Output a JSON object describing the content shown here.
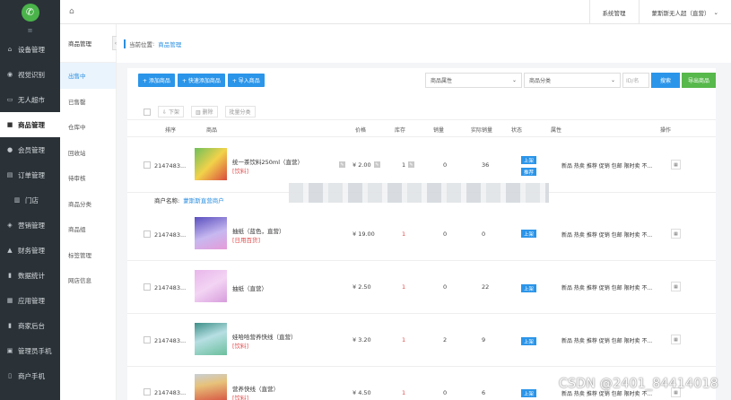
{
  "sidebar": {
    "collapse_glyph": "≡",
    "items": [
      {
        "icon": "⌂",
        "label": "设备管理"
      },
      {
        "icon": "◉",
        "label": "视觉识别"
      },
      {
        "icon": "▭",
        "label": "无人超市"
      },
      {
        "icon": "■",
        "label": "商品管理"
      },
      {
        "icon": "●",
        "label": "会员管理"
      },
      {
        "icon": "▤",
        "label": "订单管理"
      },
      {
        "icon": "▥",
        "label": "门店"
      },
      {
        "icon": "◈",
        "label": "营销管理"
      },
      {
        "icon": "▲",
        "label": "财务管理"
      },
      {
        "icon": "▮",
        "label": "数据统计"
      },
      {
        "icon": "▦",
        "label": "应用管理"
      },
      {
        "icon": "▮",
        "label": "商家后台"
      },
      {
        "icon": "▣",
        "label": "管理员手机"
      },
      {
        "icon": "▯",
        "label": "商户手机"
      }
    ]
  },
  "topbar": {
    "system_label": "系统管理",
    "user_label": "蒙斯斯无人超（直营）"
  },
  "subnav": {
    "title": "商品管理",
    "items": [
      "出售中",
      "已售罄",
      "仓库中",
      "回收站",
      "待审核",
      "商品分类",
      "商品组",
      "标签管理",
      "网店信息"
    ]
  },
  "breadcrumb": {
    "prefix": "当前位置",
    "current": "商品管理"
  },
  "toolbar": {
    "add": "+ 添加商品",
    "quick_add": "+ 快速添加商品",
    "import": "+ 导入商品",
    "attr_select": "商品属性",
    "category_select": "商品分类",
    "id_placeholder": "ID/名",
    "search": "搜索",
    "export": "导出商品"
  },
  "bulk": {
    "down": "下架",
    "delete": "删除",
    "set_category": "批量分类"
  },
  "table": {
    "headers": [
      "排序",
      "商品",
      "价格",
      "库存",
      "销量",
      "实际销量",
      "状态",
      "属性",
      "操作"
    ],
    "merchant_label": "商户名称:",
    "merchant_name": "蒙斯斯直营商户",
    "rows": [
      {
        "id": "2147483...",
        "name": "统一茶饮料250ml（直营）",
        "tag": "[饮料]",
        "price": "¥ 2.00",
        "stock": "1",
        "sales": "0",
        "real_sales": "36",
        "status": [
          "上架",
          "推荐"
        ],
        "attrs": "新品 热卖 推荐 促销 包邮 限时卖 不..."
      },
      {
        "id": "2147483...",
        "name": "抽纸（蓝色，直营）",
        "tag": "[日用百货]",
        "price": "¥ 19.00",
        "stock": "1",
        "sales": "0",
        "real_sales": "0",
        "status": [
          "上架"
        ],
        "attrs": "新品 热卖 推荐 促销 包邮 限时卖 不..."
      },
      {
        "id": "2147483...",
        "name": "抽纸（直营）",
        "tag": "",
        "price": "¥ 2.50",
        "stock": "1",
        "sales": "0",
        "real_sales": "22",
        "status": [
          "上架"
        ],
        "attrs": "新品 热卖 推荐 促销 包邮 限时卖 不..."
      },
      {
        "id": "2147483...",
        "name": "娃哈哈营养快线（直营）",
        "tag": "[饮料]",
        "price": "¥ 3.20",
        "stock": "1",
        "sales": "2",
        "real_sales": "9",
        "status": [
          "上架"
        ],
        "attrs": "新品 热卖 推荐 促销 包邮 限时卖 不..."
      },
      {
        "id": "2147483...",
        "name": "营养快线（直营）",
        "tag": "[饮料]",
        "price": "¥ 4.50",
        "stock": "1",
        "sales": "0",
        "real_sales": "6",
        "status": [
          "上架"
        ],
        "attrs": "新品 热卖 推荐 促销 包邮 限时卖 不..."
      }
    ]
  },
  "watermark": "CSDN @2401_84414018"
}
